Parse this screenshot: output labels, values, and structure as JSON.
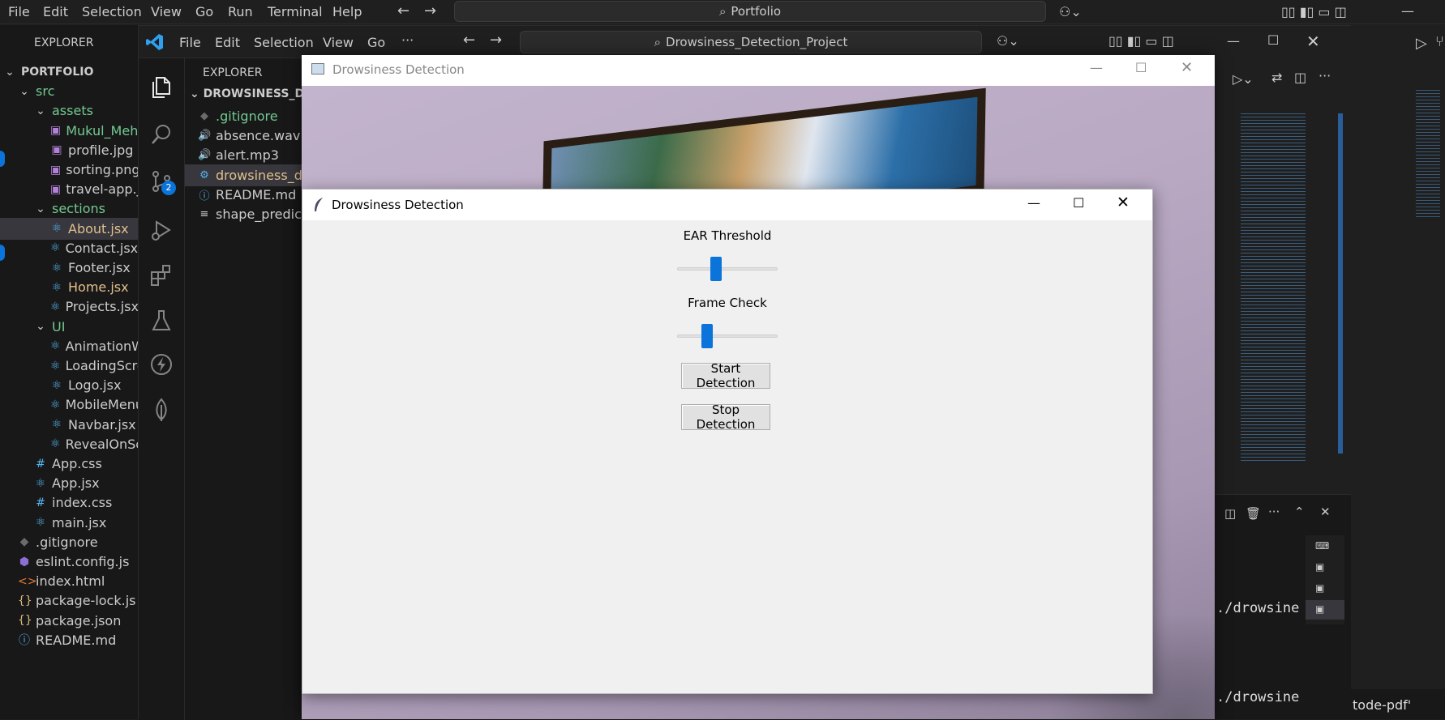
{
  "outer": {
    "menu": [
      "File",
      "Edit",
      "Selection",
      "View",
      "Go",
      "Run",
      "Terminal",
      "Help"
    ],
    "search": "Portfolio",
    "explorer_title": "EXPLORER",
    "tree": [
      {
        "label": "PORTFOLIO",
        "icon": "chevron-down-icon",
        "kind": "root"
      },
      {
        "label": "src",
        "icon": "chevron-down-icon",
        "kind": "folder"
      },
      {
        "label": "assets",
        "icon": "chevron-down-icon",
        "kind": "folder"
      },
      {
        "label": "Mukul_Mehr",
        "icon": "image-icon",
        "kind": "file"
      },
      {
        "label": "profile.jpg",
        "icon": "image-icon",
        "kind": "file"
      },
      {
        "label": "sorting.png",
        "icon": "image-icon",
        "kind": "file"
      },
      {
        "label": "travel-app.jp",
        "icon": "image-icon",
        "kind": "file"
      },
      {
        "label": "sections",
        "icon": "chevron-down-icon",
        "kind": "folder"
      },
      {
        "label": "About.jsx",
        "icon": "react-icon",
        "kind": "file-modified"
      },
      {
        "label": "Contact.jsx",
        "icon": "react-icon",
        "kind": "file"
      },
      {
        "label": "Footer.jsx",
        "icon": "react-icon",
        "kind": "file"
      },
      {
        "label": "Home.jsx",
        "icon": "react-icon",
        "kind": "file-modified"
      },
      {
        "label": "Projects.jsx",
        "icon": "react-icon",
        "kind": "file"
      },
      {
        "label": "UI",
        "icon": "chevron-down-icon",
        "kind": "folder"
      },
      {
        "label": "AnimationW",
        "icon": "react-icon",
        "kind": "file"
      },
      {
        "label": "LoadingScre",
        "icon": "react-icon",
        "kind": "file"
      },
      {
        "label": "Logo.jsx",
        "icon": "react-icon",
        "kind": "file"
      },
      {
        "label": "MobileMenu",
        "icon": "react-icon",
        "kind": "file"
      },
      {
        "label": "Navbar.jsx",
        "icon": "react-icon",
        "kind": "file"
      },
      {
        "label": "RevealOnScr",
        "icon": "react-icon",
        "kind": "file"
      },
      {
        "label": "App.css",
        "icon": "hash-icon",
        "kind": "file"
      },
      {
        "label": "App.jsx",
        "icon": "react-icon",
        "kind": "file"
      },
      {
        "label": "index.css",
        "icon": "hash-icon",
        "kind": "file"
      },
      {
        "label": "main.jsx",
        "icon": "react-icon",
        "kind": "file"
      },
      {
        "label": ".gitignore",
        "icon": "git-icon",
        "kind": "file"
      },
      {
        "label": "eslint.config.js",
        "icon": "eslint-icon",
        "kind": "file"
      },
      {
        "label": "index.html",
        "icon": "html-icon",
        "kind": "file"
      },
      {
        "label": "package-lock.js",
        "icon": "braces-icon",
        "kind": "file"
      },
      {
        "label": "package.json",
        "icon": "braces-icon",
        "kind": "file"
      },
      {
        "label": "README.md",
        "icon": "info-icon",
        "kind": "file"
      }
    ],
    "terminal_lines": [
      "./drowsine",
      "./drowsine"
    ],
    "bottom_tab": "tode-pdf'"
  },
  "inner": {
    "menu": [
      "File",
      "Edit",
      "Selection",
      "View",
      "Go",
      "···"
    ],
    "search": "Drowsiness_Detection_Project",
    "explorer_title": "EXPLORER",
    "project": "DROWSINESS_DET",
    "scm_badge": "2",
    "files": [
      {
        "label": ".gitignore",
        "icon": "git-icon"
      },
      {
        "label": "absence.wav",
        "icon": "audio-icon"
      },
      {
        "label": "alert.mp3",
        "icon": "audio-icon"
      },
      {
        "label": "drowsiness_de",
        "icon": "python-icon",
        "selected": true
      },
      {
        "label": "README.md",
        "icon": "info-icon"
      },
      {
        "label": "shape_predicto",
        "icon": "lines-icon"
      }
    ]
  },
  "cam_window": {
    "title": "Drowsiness Detection"
  },
  "tk_window": {
    "title": "Drowsiness Detection",
    "ear_label": "EAR Threshold",
    "ear_value": 0.37,
    "frame_label": "Frame Check",
    "frame_value": 0.27,
    "start_label": "Start Detection",
    "stop_label": "Stop Detection"
  },
  "colors": {
    "accent": "#0a74da",
    "vscode_bg": "#181818",
    "modified": "#e2c08d",
    "untracked": "#73c991"
  }
}
